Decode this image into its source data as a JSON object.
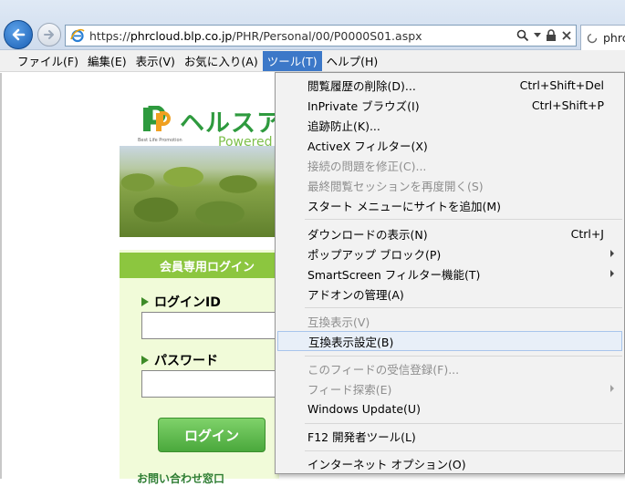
{
  "address_bar": {
    "url_prefix": "https://",
    "url_host": "phrcloud.blp.co.jp",
    "url_path": "/PHR/Personal/00/P0000S01.aspx",
    "tab_title": "phrc"
  },
  "menubar": {
    "items": [
      "ファイル(F)",
      "編集(E)",
      "表示(V)",
      "お気に入り(A)",
      "ツール(T)",
      "ヘルプ(H)"
    ]
  },
  "page": {
    "logo_text": "ヘルスア",
    "logo_powered": "Powered",
    "logo_sub": "Best Life Promotion",
    "login_header": "会員専用ログイン",
    "login_id_label": "ログインID",
    "password_label": "パスワード",
    "login_button": "ログイン",
    "cut_link": "お問い合わせ窓口"
  },
  "tools_menu": {
    "items": [
      {
        "label": "閲覧履歴の削除(D)...",
        "shortcut": "Ctrl+Shift+Del"
      },
      {
        "label": "InPrivate ブラウズ(I)",
        "shortcut": "Ctrl+Shift+P"
      },
      {
        "label": "追跡防止(K)..."
      },
      {
        "label": "ActiveX フィルター(X)"
      },
      {
        "label": "接続の問題を修正(C)..."
      },
      {
        "label": "最終閲覧セッションを再度開く(S)"
      },
      {
        "label": "スタート メニューにサイトを追加(M)"
      },
      {
        "label": "ダウンロードの表示(N)",
        "shortcut": "Ctrl+J"
      },
      {
        "label": "ポップアップ ブロック(P)"
      },
      {
        "label": "SmartScreen フィルター機能(T)"
      },
      {
        "label": "アドオンの管理(A)"
      },
      {
        "label": "互換表示(V)"
      },
      {
        "label": "互換表示設定(B)"
      },
      {
        "label": "このフィードの受信登録(F)..."
      },
      {
        "label": "フィード探索(E)"
      },
      {
        "label": "Windows Update(U)"
      },
      {
        "label": "F12 開発者ツール(L)"
      },
      {
        "label": "インターネット オプション(O)"
      }
    ]
  },
  "colors": {
    "menu_active": "#3c78c8",
    "login_green": "#8cc63f",
    "logo_green": "#2e9a3e"
  }
}
